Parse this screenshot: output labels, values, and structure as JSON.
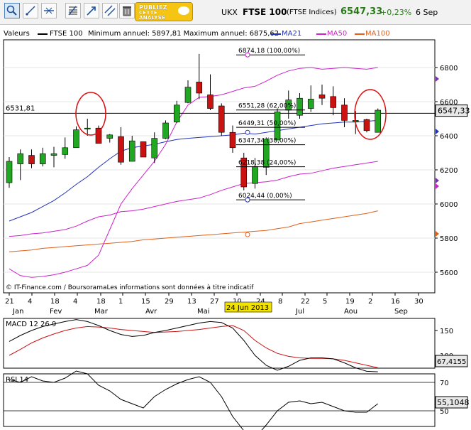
{
  "toolbar": {
    "buttons": [
      "zoom-icon",
      "line-draw-icon",
      "horizontal-line-icon",
      "fibonacci-icon",
      "trend-arrow-icon",
      "parallel-lines-icon",
      "trash-icon"
    ],
    "promo_line1": "PUBLIEZ",
    "promo_line2": "CETTE",
    "promo_line3": "ANALYSE"
  },
  "header": {
    "symbol": "UKX",
    "name": "FTSE 100",
    "exchange": "(FTSE Indices)",
    "price": "6547,33",
    "change": "+0,23%",
    "date": "6 Sep"
  },
  "legend": {
    "values_label": "Valeurs",
    "series_label": "FTSE 100",
    "minmax": "Minimum annuel: 5897,81 Maximum annuel: 6875,62",
    "ma21": "MA21",
    "ma50": "MA50",
    "ma100": "MA100"
  },
  "colors": {
    "up": "#22a722",
    "down": "#cc1111",
    "ma21": "#2233bb",
    "ma50": "#cc22cc",
    "ma100": "#e0601a",
    "ellipse": "#dd1111",
    "macd": "#000000",
    "signal": "#cc1111"
  },
  "price_axis": {
    "ticks": [
      "6800",
      "6600",
      "6400",
      "6200",
      "6000",
      "5800",
      "5600"
    ],
    "reference_line_label": "6531,81",
    "last_price_label": "6547,33"
  },
  "date_axis": {
    "day_ticks": [
      "21",
      "4",
      "18",
      "4",
      "18",
      "1",
      "15",
      "29",
      "13",
      "27",
      "10",
      "24",
      "8",
      "22",
      "5",
      "19",
      "2",
      "16",
      "30"
    ],
    "month_labels": [
      "Jan",
      "Fev",
      "Mar",
      "Avr",
      "Mai",
      "Jul",
      "Aou",
      "Sep"
    ],
    "highlight_date": "24 Jun 2013"
  },
  "fibonacci": {
    "levels": [
      "6874,18 (100,00%)",
      "6551,28 (62,00%)",
      "6449,31 (50,00%)",
      "6347,34 (38,00%)",
      "6218,38 (24,00%)",
      "6024,44 (0,00%)"
    ]
  },
  "watermark": "© IT-Finance.com / BoursoramaLes informations sont données à titre indicatif",
  "macd": {
    "label": "MACD 12 26 9",
    "ticks": [
      "150",
      "100"
    ],
    "last_value": "67,4155"
  },
  "rsi": {
    "label": "RSI 14",
    "ticks": [
      "70",
      "50"
    ],
    "last_value": "55,1048"
  },
  "chart_data": {
    "type": "candlestick",
    "title": "FTSE 100",
    "ylim": [
      5500,
      6920
    ],
    "candles": [
      [
        6125,
        6275,
        6095,
        6250
      ],
      [
        6235,
        6320,
        6140,
        6295
      ],
      [
        6285,
        6320,
        6210,
        6235
      ],
      [
        6235,
        6330,
        6220,
        6295
      ],
      [
        6285,
        6335,
        6215,
        6295
      ],
      [
        6290,
        6390,
        6265,
        6330
      ],
      [
        6330,
        6455,
        6335,
        6435
      ],
      [
        6440,
        6500,
        6400,
        6445
      ],
      [
        6445,
        6460,
        6365,
        6355
      ],
      [
        6385,
        6410,
        6360,
        6405
      ],
      [
        6395,
        6450,
        6230,
        6245
      ],
      [
        6250,
        6400,
        6250,
        6370
      ],
      [
        6365,
        6360,
        6300,
        6275
      ],
      [
        6270,
        6420,
        6240,
        6385
      ],
      [
        6385,
        6490,
        6380,
        6475
      ],
      [
        6480,
        6605,
        6475,
        6580
      ],
      [
        6595,
        6725,
        6590,
        6685
      ],
      [
        6715,
        6880,
        6615,
        6650
      ],
      [
        6640,
        6760,
        6550,
        6560
      ],
      [
        6575,
        6590,
        6400,
        6420
      ],
      [
        6420,
        6460,
        6300,
        6330
      ],
      [
        6270,
        6300,
        6080,
        6100
      ],
      [
        6120,
        6270,
        6090,
        6220
      ],
      [
        6215,
        6390,
        6170,
        6380
      ],
      [
        6375,
        6560,
        6380,
        6540
      ],
      [
        6550,
        6665,
        6500,
        6610
      ],
      [
        6520,
        6650,
        6500,
        6620
      ],
      [
        6560,
        6695,
        6540,
        6615
      ],
      [
        6640,
        6700,
        6580,
        6620
      ],
      [
        6630,
        6690,
        6520,
        6565
      ],
      [
        6580,
        6620,
        6450,
        6490
      ],
      [
        6490,
        6545,
        6410,
        6490
      ],
      [
        6495,
        6500,
        6420,
        6430
      ],
      [
        6420,
        6560,
        6425,
        6550
      ]
    ],
    "ma21": [
      5900,
      5925,
      5950,
      5985,
      6020,
      6065,
      6115,
      6160,
      6215,
      6265,
      6310,
      6330,
      6340,
      6350,
      6365,
      6378,
      6385,
      6390,
      6395,
      6400,
      6405,
      6415,
      6410,
      6420,
      6430,
      6440,
      6450,
      6460,
      6470,
      6475,
      6480,
      6480,
      6485,
      6490
    ],
    "ma50": [
      5620,
      5580,
      5570,
      5575,
      5585,
      5600,
      5620,
      5640,
      5700,
      5850,
      6000,
      6090,
      6170,
      6250,
      6350,
      6480,
      6580,
      6625,
      6630,
      6640,
      6660,
      6680,
      6690,
      6720,
      6755,
      6780,
      6795,
      6800,
      6790,
      6795,
      6800,
      6795,
      6790,
      6800
    ],
    "ma100": [
      5720,
      5725,
      5730,
      5740,
      5745,
      5750,
      5755,
      5760,
      5765,
      5770,
      5775,
      5780,
      5790,
      5795,
      5800,
      5805,
      5810,
      5815,
      5820,
      5825,
      5830,
      5835,
      5840,
      5845,
      5855,
      5865,
      5885,
      5895,
      5905,
      5915,
      5925,
      5935,
      5945,
      5960
    ],
    "ma_lower_purple": [
      5810,
      5815,
      5825,
      5830,
      5840,
      5850,
      5870,
      5900,
      5925,
      5935,
      5955,
      5960,
      5970,
      5985,
      6000,
      6015,
      6025,
      6035,
      6055,
      6080,
      6100,
      6120,
      6125,
      6130,
      6140,
      6160,
      6175,
      6180,
      6195,
      6210,
      6220,
      6230,
      6240,
      6250
    ],
    "macd": [
      128,
      140,
      150,
      158,
      163,
      168,
      172,
      168,
      160,
      150,
      142,
      138,
      140,
      146,
      150,
      155,
      160,
      165,
      168,
      166,
      155,
      130,
      100,
      80,
      70,
      78,
      90,
      95,
      95,
      93,
      85,
      75,
      68,
      67
    ],
    "signal": [
      100,
      112,
      125,
      135,
      143,
      150,
      155,
      158,
      157,
      155,
      152,
      150,
      148,
      146,
      147,
      148,
      150,
      152,
      155,
      158,
      160,
      150,
      130,
      115,
      104,
      98,
      95,
      94,
      94,
      93,
      90,
      85,
      80,
      75
    ],
    "rsi": [
      72,
      70,
      74,
      71,
      70,
      73,
      78,
      76,
      68,
      64,
      58,
      55,
      52,
      60,
      65,
      69,
      72,
      74,
      70,
      60,
      46,
      36,
      31,
      40,
      50,
      56,
      57,
      55,
      56,
      53,
      50,
      49,
      49,
      55
    ]
  }
}
